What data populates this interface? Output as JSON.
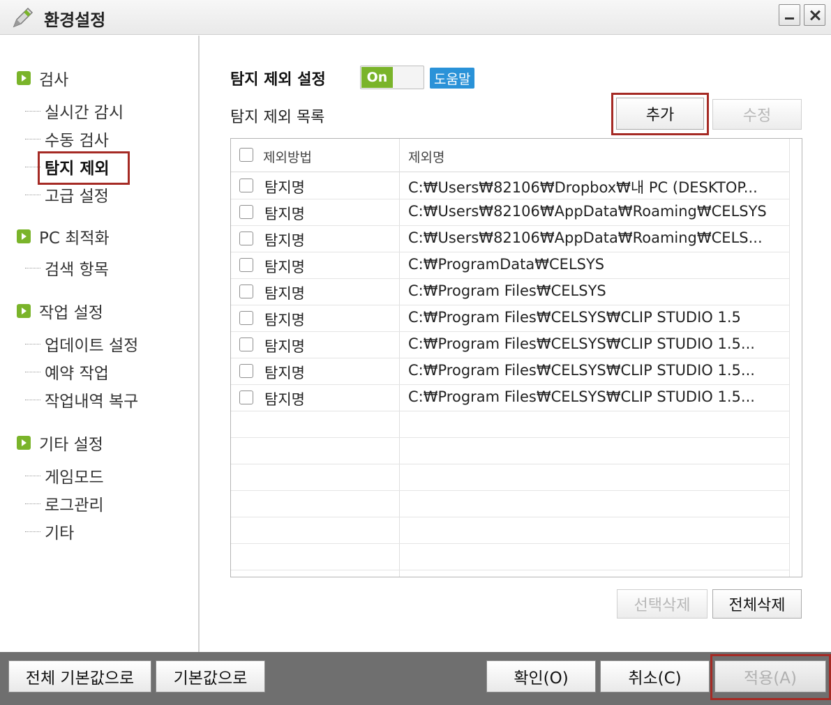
{
  "window": {
    "title": "환경설정"
  },
  "sidebar": {
    "categories": [
      {
        "label": "검사",
        "items": [
          "실시간 감시",
          "수동 검사",
          "탐지 제외",
          "고급 설정"
        ]
      },
      {
        "label": "PC 최적화",
        "items": [
          "검색 항목"
        ]
      },
      {
        "label": "작업 설정",
        "items": [
          "업데이트 설정",
          "예약 작업",
          "작업내역 복구"
        ]
      },
      {
        "label": "기타 설정",
        "items": [
          "게임모드",
          "로그관리",
          "기타"
        ]
      }
    ],
    "selected": "탐지 제외"
  },
  "content": {
    "section_title": "탐지 제외 설정",
    "toggle_label": "On",
    "help_label": "도움말",
    "list_title": "탐지 제외 목록",
    "add_label": "추가",
    "edit_label": "수정",
    "columns": [
      "제외방법",
      "제외명"
    ],
    "rows": [
      {
        "method": "탐지명",
        "name": "C:₩Users₩82106₩Dropbox₩내 PC (DESKTOP..."
      },
      {
        "method": "탐지명",
        "name": "C:₩Users₩82106₩AppData₩Roaming₩CELSYS"
      },
      {
        "method": "탐지명",
        "name": "C:₩Users₩82106₩AppData₩Roaming₩CELS..."
      },
      {
        "method": "탐지명",
        "name": "C:₩ProgramData₩CELSYS"
      },
      {
        "method": "탐지명",
        "name": "C:₩Program Files₩CELSYS"
      },
      {
        "method": "탐지명",
        "name": "C:₩Program Files₩CELSYS₩CLIP STUDIO 1.5"
      },
      {
        "method": "탐지명",
        "name": "C:₩Program Files₩CELSYS₩CLIP STUDIO 1.5..."
      },
      {
        "method": "탐지명",
        "name": "C:₩Program Files₩CELSYS₩CLIP STUDIO 1.5..."
      },
      {
        "method": "탐지명",
        "name": "C:₩Program Files₩CELSYS₩CLIP STUDIO 1.5..."
      }
    ],
    "delete_selected_label": "선택삭제",
    "delete_all_label": "전체삭제"
  },
  "footer": {
    "reset_all_label": "전체 기본값으로",
    "reset_label": "기본값으로",
    "ok_label": "확인(O)",
    "cancel_label": "취소(C)",
    "apply_label": "적용(A)"
  },
  "colors": {
    "accent_green": "#7ab42a",
    "help_blue": "#2a92d8",
    "highlight_red": "#a52a24"
  }
}
